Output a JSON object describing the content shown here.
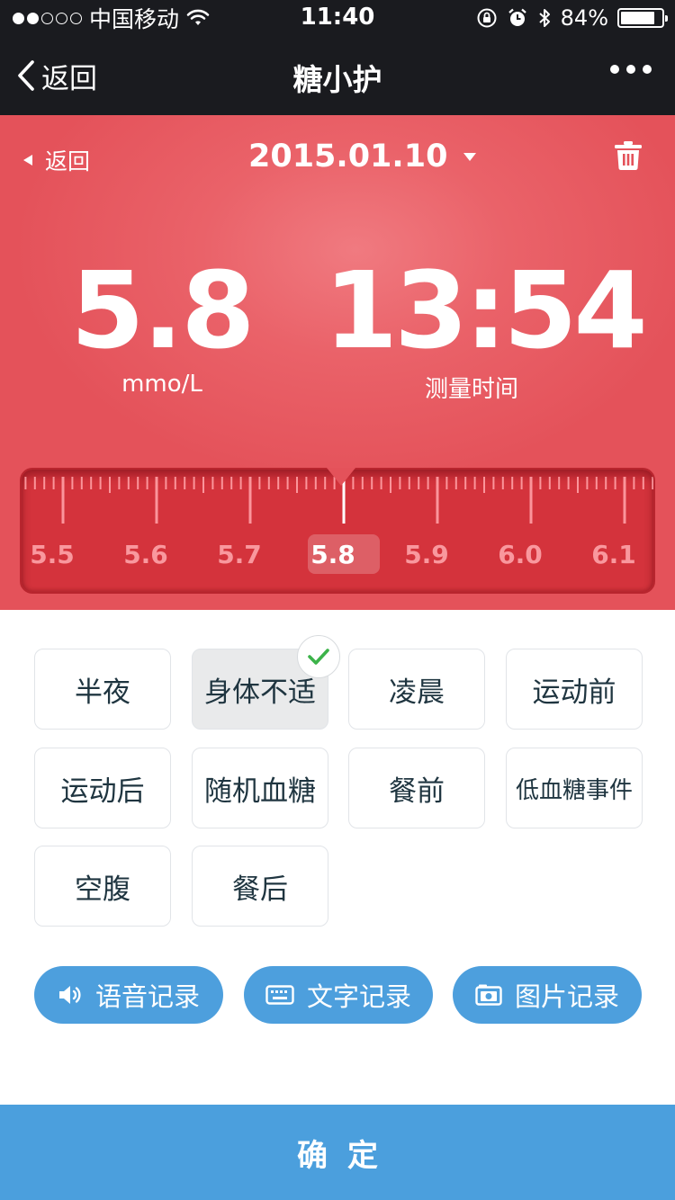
{
  "status_bar": {
    "carrier": "中国移动",
    "time": "11:40",
    "battery": "84%",
    "battery_level": 0.84,
    "signal_strength": 2
  },
  "nav": {
    "back_label": "返回",
    "title": "糖小护"
  },
  "header": {
    "back_label": "返回",
    "date": "2015.01.10",
    "reading_value": "5.8",
    "reading_unit": "mmo/L",
    "time_value": "13:54",
    "time_label": "测量时间"
  },
  "ruler": {
    "labels": [
      "5.5",
      "5.6",
      "5.7",
      "5.8",
      "5.9",
      "6.0",
      "6.1"
    ],
    "selected": "5.8"
  },
  "tags": [
    {
      "label": "半夜",
      "selected": false
    },
    {
      "label": "身体不适",
      "selected": true
    },
    {
      "label": "凌晨",
      "selected": false
    },
    {
      "label": "运动前",
      "selected": false
    },
    {
      "label": "运动后",
      "selected": false
    },
    {
      "label": "随机血糖",
      "selected": false
    },
    {
      "label": "餐前",
      "selected": false
    },
    {
      "label": "低血糖事件",
      "selected": false
    },
    {
      "label": "空腹",
      "selected": false
    },
    {
      "label": "餐后",
      "selected": false
    }
  ],
  "record_buttons": {
    "voice": "语音记录",
    "text": "文字记录",
    "image": "图片记录"
  },
  "confirm_label": "确定",
  "colors": {
    "header_red": "#e4525a",
    "ruler_red": "#d4333c",
    "accent_blue": "#4d9fdd",
    "check_green": "#3cb34a",
    "nav_dark": "#1a1b1f"
  },
  "icons": {
    "back": "chevron-left-icon",
    "more": "more-dots-icon",
    "trash": "trash-icon",
    "voice": "speaker-icon",
    "text": "keyboard-icon",
    "image": "camera-icon",
    "check": "check-icon"
  }
}
